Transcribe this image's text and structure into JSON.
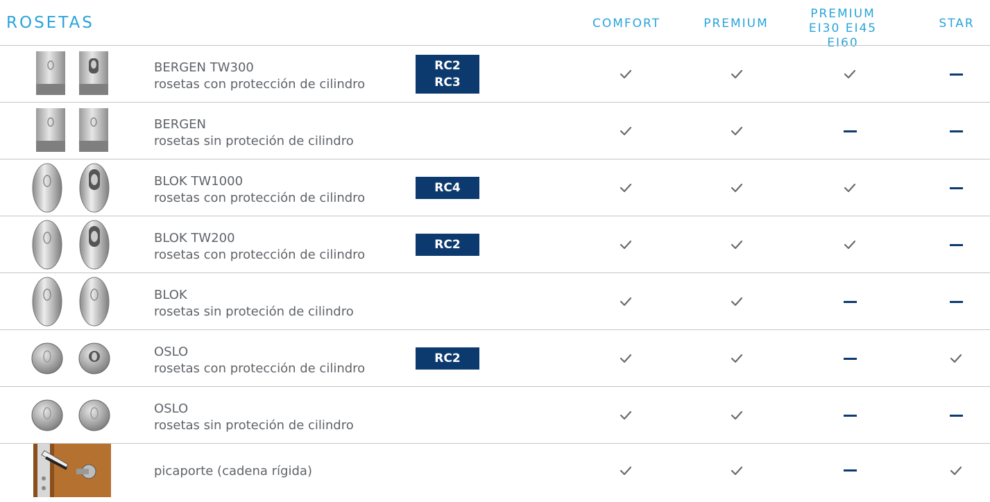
{
  "header": {
    "title": "ROSETAS",
    "columns": [
      "COMFORT",
      "PREMIUM",
      "PREMIUM",
      "STAR"
    ],
    "premium_ei_subtitle": "EI30 EI45 EI60"
  },
  "colors": {
    "accent": "#29a3db",
    "badge": "#0d3a6e",
    "check": "#6a6a6a",
    "text": "#5f6368"
  },
  "rows": [
    {
      "thumb": "bergen-square-icon",
      "line1": "BERGEN TW300",
      "line2": "rosetas con protección de cilindro",
      "badges": [
        "RC2",
        "RC3"
      ],
      "cells": [
        "check",
        "check",
        "check",
        "dash"
      ]
    },
    {
      "thumb": "bergen-square-icon",
      "line1": "BERGEN",
      "line2": "rosetas sin proteción de cilindro",
      "badges": [],
      "cells": [
        "check",
        "check",
        "dash",
        "dash"
      ]
    },
    {
      "thumb": "blok-oval-icon",
      "line1": "BLOK TW1000",
      "line2": "rosetas con protección de cilindro",
      "badges": [
        "RC4"
      ],
      "cells": [
        "check",
        "check",
        "check",
        "dash"
      ]
    },
    {
      "thumb": "blok-oval-icon",
      "line1": "BLOK TW200",
      "line2": "rosetas con protección de cilindro",
      "badges": [
        "RC2"
      ],
      "cells": [
        "check",
        "check",
        "check",
        "dash"
      ]
    },
    {
      "thumb": "blok-oval-icon",
      "line1": "BLOK",
      "line2": "rosetas sin proteción de cilindro",
      "badges": [],
      "cells": [
        "check",
        "check",
        "dash",
        "dash"
      ]
    },
    {
      "thumb": "oslo-round-icon",
      "line1": "OSLO",
      "line2": "rosetas con protección de cilindro",
      "badges": [
        "RC2"
      ],
      "cells": [
        "check",
        "check",
        "dash",
        "check"
      ]
    },
    {
      "thumb": "oslo-round-icon",
      "line1": "OSLO",
      "line2": "rosetas sin proteción de cilindro",
      "badges": [],
      "cells": [
        "check",
        "check",
        "dash",
        "dash"
      ]
    },
    {
      "thumb": "door-chain-photo-icon",
      "line1": "picaporte (cadena rígida)",
      "line2": "",
      "badges": [],
      "cells": [
        "check",
        "check",
        "dash",
        "check"
      ]
    }
  ]
}
